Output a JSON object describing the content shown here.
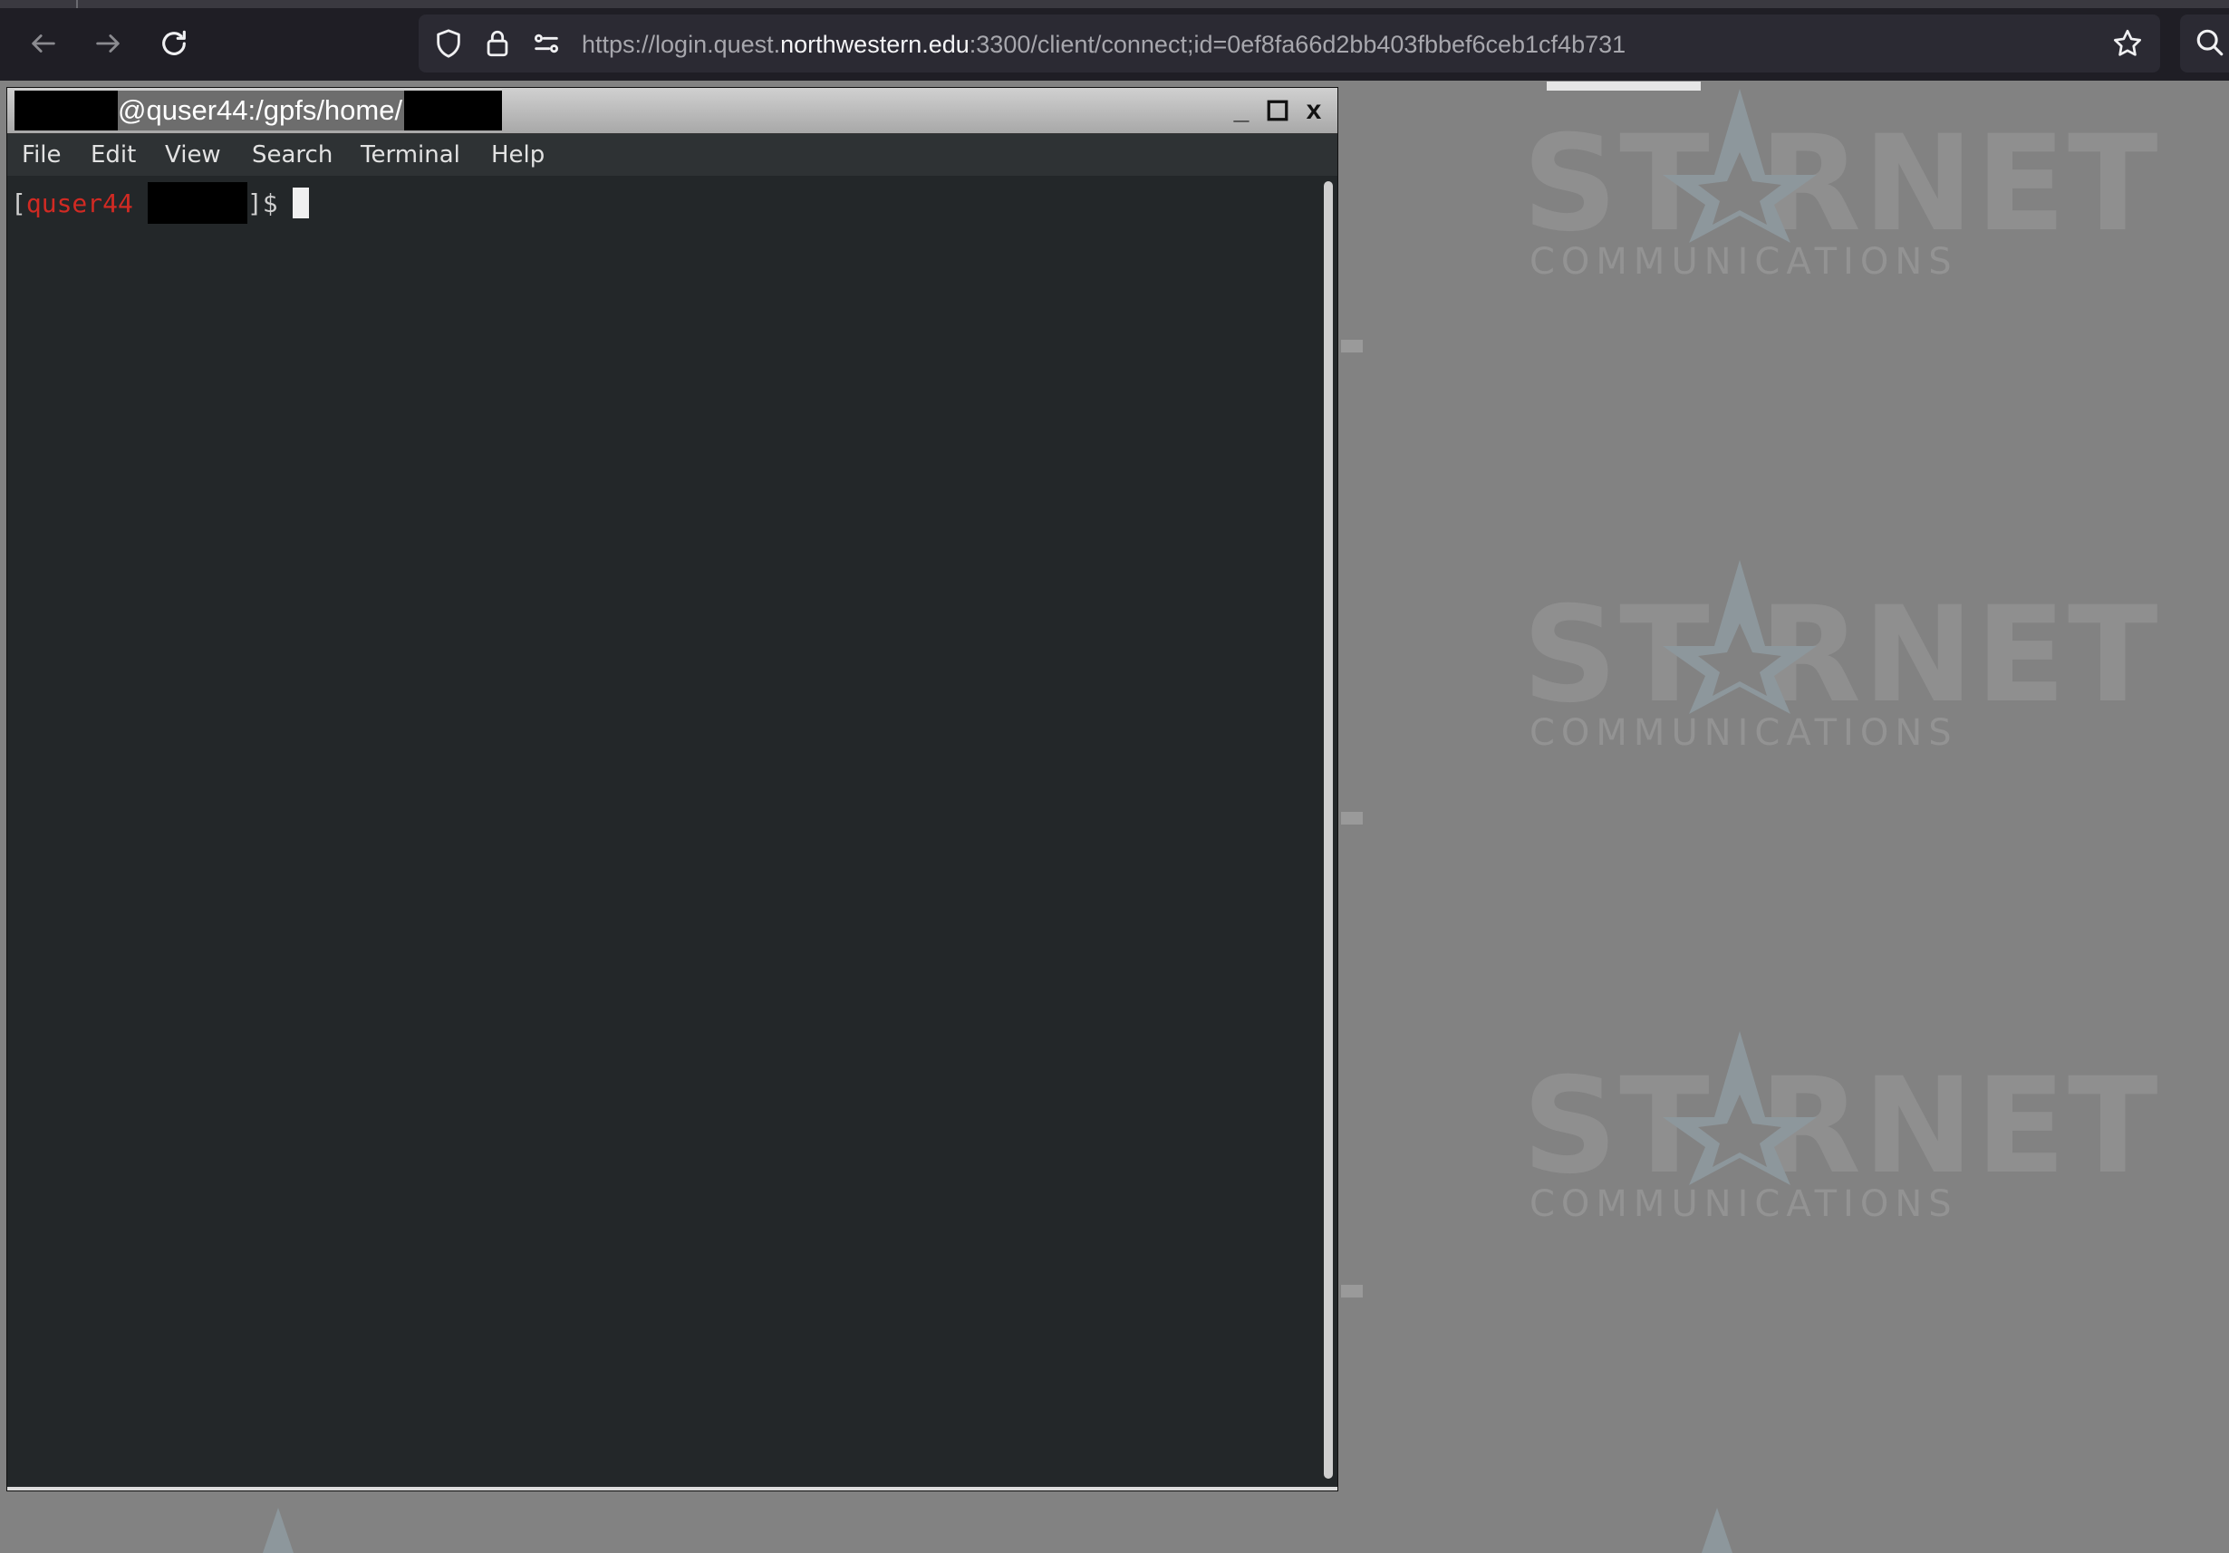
{
  "browser": {
    "url_prefix": "https://login.quest.",
    "url_domain": "northwestern.edu",
    "url_suffix": ":3300/client/connect;id=0ef8fa66d2bb403fbbef6ceb1cf4b731",
    "icons": {
      "back": "arrow-left-icon",
      "forward": "arrow-right-icon",
      "reload": "reload-icon",
      "shield": "shield-icon",
      "lock": "lock-icon",
      "permissions": "permissions-icon",
      "bookmark": "star-icon",
      "search": "search-icon"
    }
  },
  "terminal": {
    "title": "@quser44:/gpfs/home/",
    "controls": {
      "minimize": "_",
      "maximize": "☐",
      "close": "x"
    },
    "menu": [
      "File",
      "Edit",
      "View",
      "Search",
      "Terminal",
      "Help"
    ],
    "prompt": {
      "open": "[",
      "user": "quser44",
      "close": "]$"
    },
    "colors": {
      "prompt_user": "#d12a23",
      "background": "#232729"
    }
  },
  "desktop": {
    "watermark_brand": "ST RNET",
    "watermark_sub": "COMMUNICATIONS",
    "watermark_icon": "star-logo-icon"
  }
}
